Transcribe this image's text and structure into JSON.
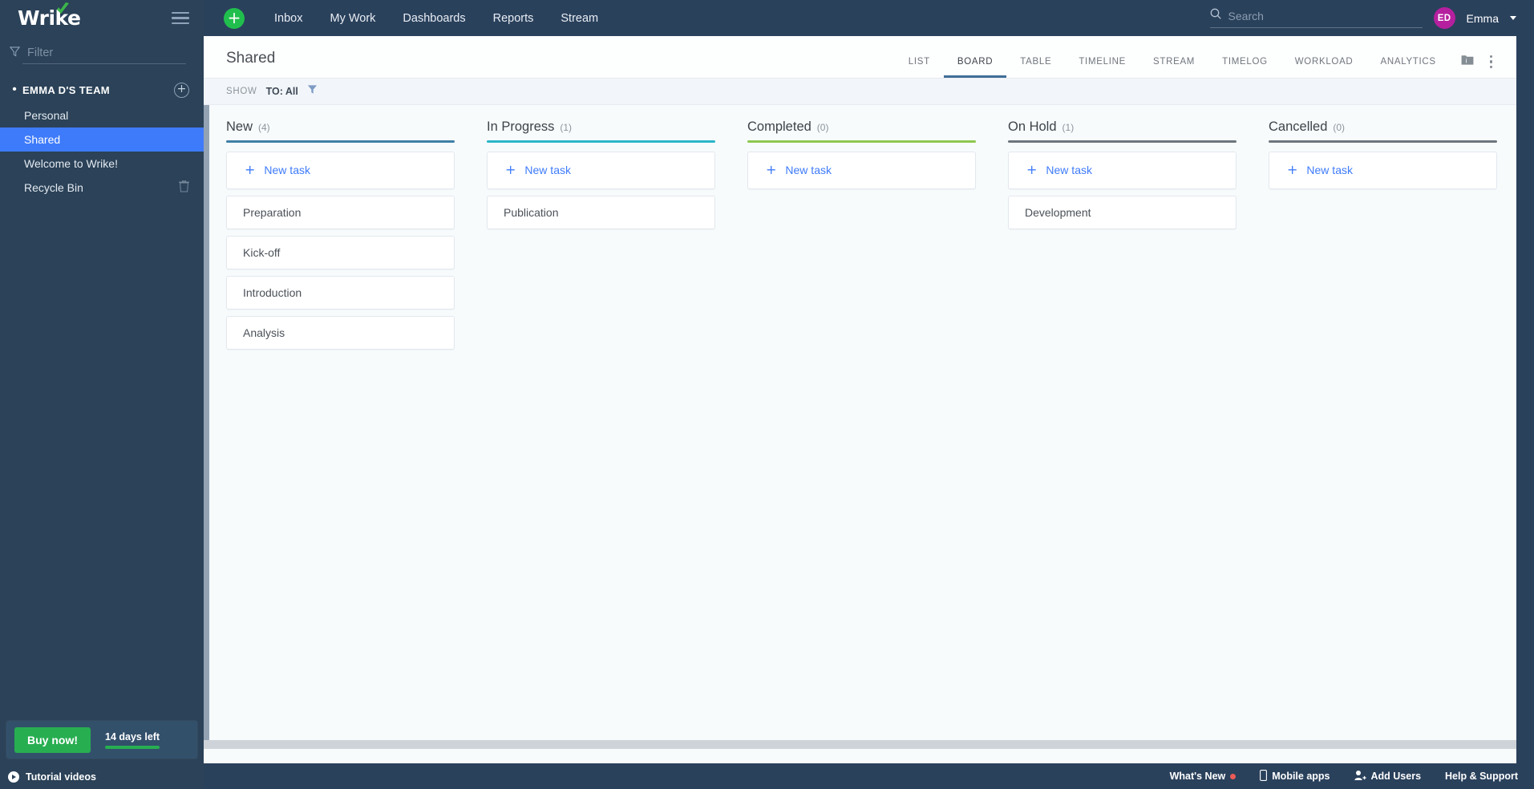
{
  "brand": {
    "logo_text": "Wrike",
    "accent_green": "#20bf4d",
    "accent_blue": "#3e7bfa",
    "sidebar_bg": "#2b4258",
    "topnav_bg": "#2a415c"
  },
  "sidebar": {
    "menu_icon": "hamburger-icon",
    "filter": {
      "placeholder": "Filter",
      "value": "",
      "icon": "funnel-icon"
    },
    "team": {
      "label": "EMMA D'S TEAM",
      "add_icon": "plus-circle-icon",
      "bullet": "•"
    },
    "items": [
      {
        "label": "Personal",
        "active": false,
        "trailing_icon": ""
      },
      {
        "label": "Shared",
        "active": true,
        "trailing_icon": ""
      },
      {
        "label": "Welcome to Wrike!",
        "active": false,
        "trailing_icon": ""
      },
      {
        "label": "Recycle Bin",
        "active": false,
        "trailing_icon": "trash-icon"
      }
    ],
    "promo": {
      "buy_label": "Buy now!",
      "days_label": "14 days left",
      "progress_color": "#27ae51"
    },
    "tutorial": {
      "label": "Tutorial videos",
      "icon": "play-circle-icon"
    }
  },
  "topnav": {
    "menu_icon": "hamburger-icon",
    "add_button_label": "+",
    "links": [
      "Inbox",
      "My Work",
      "Dashboards",
      "Reports",
      "Stream"
    ],
    "search": {
      "placeholder": "Search",
      "value": "",
      "icon": "search-icon"
    },
    "user": {
      "initials": "ED",
      "name": "Emma",
      "avatar_color": "#b5209f"
    }
  },
  "main": {
    "page_title": "Shared",
    "view_tabs": [
      {
        "label": "LIST",
        "active": false
      },
      {
        "label": "BOARD",
        "active": true
      },
      {
        "label": "TABLE",
        "active": false
      },
      {
        "label": "TIMELINE",
        "active": false
      },
      {
        "label": "STREAM",
        "active": false
      },
      {
        "label": "TIMELOG",
        "active": false
      },
      {
        "label": "WORKLOAD",
        "active": false
      },
      {
        "label": "ANALYTICS",
        "active": false
      }
    ],
    "head_icons": [
      {
        "name": "folder-info-icon"
      },
      {
        "name": "more-vertical-icon"
      }
    ],
    "filter_bar": {
      "show_label": "SHOW",
      "filter_value": "TO: All",
      "funnel_icon": "funnel-icon"
    }
  },
  "board": {
    "new_task_label": "New task",
    "columns": [
      {
        "name": "New",
        "count": "(4)",
        "rule_color": "#3f7fa6",
        "tasks": [
          {
            "title": "Preparation"
          },
          {
            "title": "Kick-off"
          },
          {
            "title": "Introduction"
          },
          {
            "title": "Analysis"
          }
        ]
      },
      {
        "name": "In Progress",
        "count": "(1)",
        "rule_color": "#2bb5c8",
        "tasks": [
          {
            "title": "Publication"
          }
        ]
      },
      {
        "name": "Completed",
        "count": "(0)",
        "rule_color": "#8fc74f",
        "tasks": []
      },
      {
        "name": "On Hold",
        "count": "(1)",
        "rule_color": "#6c757d",
        "tasks": [
          {
            "title": "Development"
          }
        ]
      },
      {
        "name": "Cancelled",
        "count": "(0)",
        "rule_color": "#6c757d",
        "tasks": []
      }
    ]
  },
  "bottombar": {
    "items": [
      {
        "label": "What's New",
        "icon": "red-dot-icon"
      },
      {
        "label": "Mobile apps",
        "icon": "mobile-icon"
      },
      {
        "label": "Add Users",
        "icon": "add-user-icon"
      },
      {
        "label": "Help & Support",
        "icon": ""
      }
    ]
  }
}
